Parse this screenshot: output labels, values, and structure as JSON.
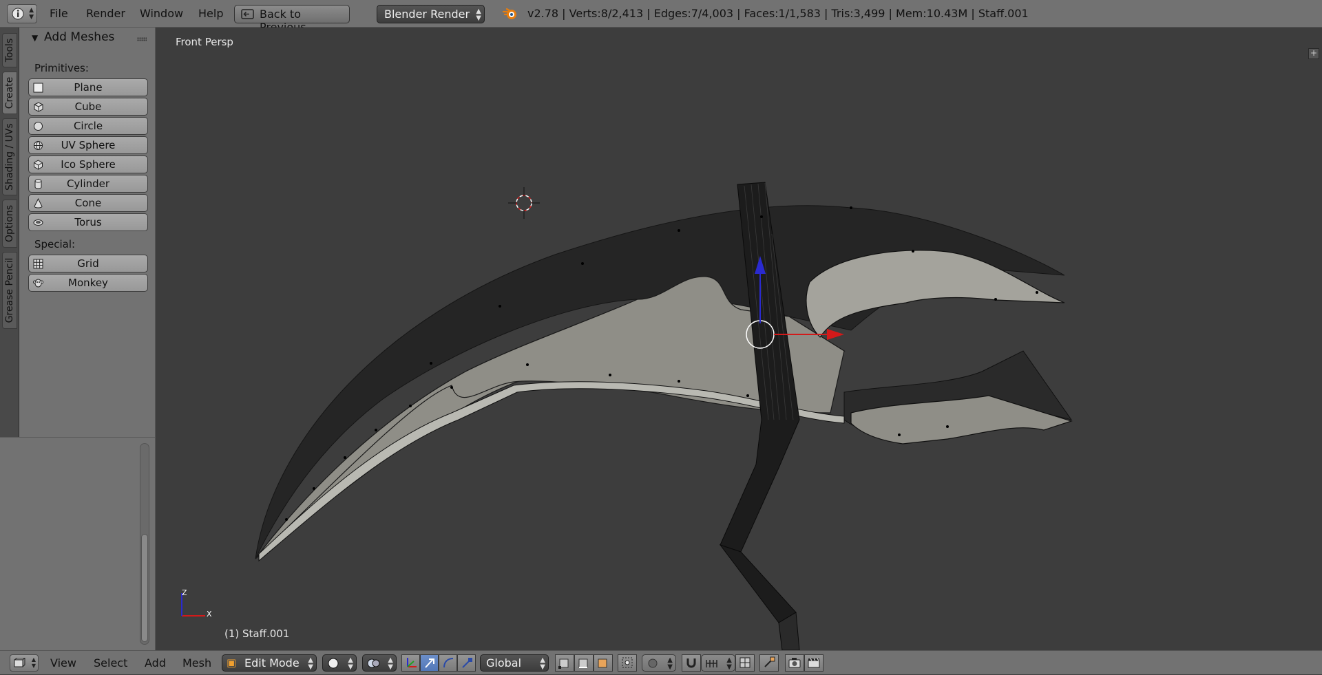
{
  "topbar": {
    "menus": [
      "File",
      "Render",
      "Window",
      "Help"
    ],
    "back_button": "Back to Previous",
    "render_engine": "Blender Render",
    "stats": "v2.78 | Verts:8/2,413 | Edges:7/4,003 | Faces:1/1,583 | Tris:3,499 | Mem:10.43M | Staff.001"
  },
  "tool_shelf": {
    "tabs": [
      "Tools",
      "Create",
      "Shading / UVs",
      "Options",
      "Grease Pencil"
    ],
    "active_tab": "Create",
    "panel_title": "Add Meshes",
    "primitives_label": "Primitives:",
    "primitives": [
      {
        "label": "Plane",
        "icon": "plane-icon"
      },
      {
        "label": "Cube",
        "icon": "cube-icon"
      },
      {
        "label": "Circle",
        "icon": "circle-icon"
      },
      {
        "label": "UV Sphere",
        "icon": "uv-sphere-icon"
      },
      {
        "label": "Ico Sphere",
        "icon": "ico-sphere-icon"
      },
      {
        "label": "Cylinder",
        "icon": "cylinder-icon"
      },
      {
        "label": "Cone",
        "icon": "cone-icon"
      },
      {
        "label": "Torus",
        "icon": "torus-icon"
      }
    ],
    "special_label": "Special:",
    "special": [
      {
        "label": "Grid",
        "icon": "grid-icon"
      },
      {
        "label": "Monkey",
        "icon": "monkey-icon"
      }
    ]
  },
  "viewport": {
    "view_name": "Front Persp",
    "object_label": "(1) Staff.001",
    "axis_z": "Z",
    "axis_x": "X"
  },
  "bottombar": {
    "menus": [
      "View",
      "Select",
      "Add",
      "Mesh"
    ],
    "mode": "Edit Mode",
    "orientation": "Global"
  },
  "colors": {
    "accent_blue": "#5278b8",
    "header_gray": "#727272",
    "viewport_bg": "#3d3d3d",
    "blade_light": "#8f8e87",
    "blade_dark": "#252525"
  }
}
